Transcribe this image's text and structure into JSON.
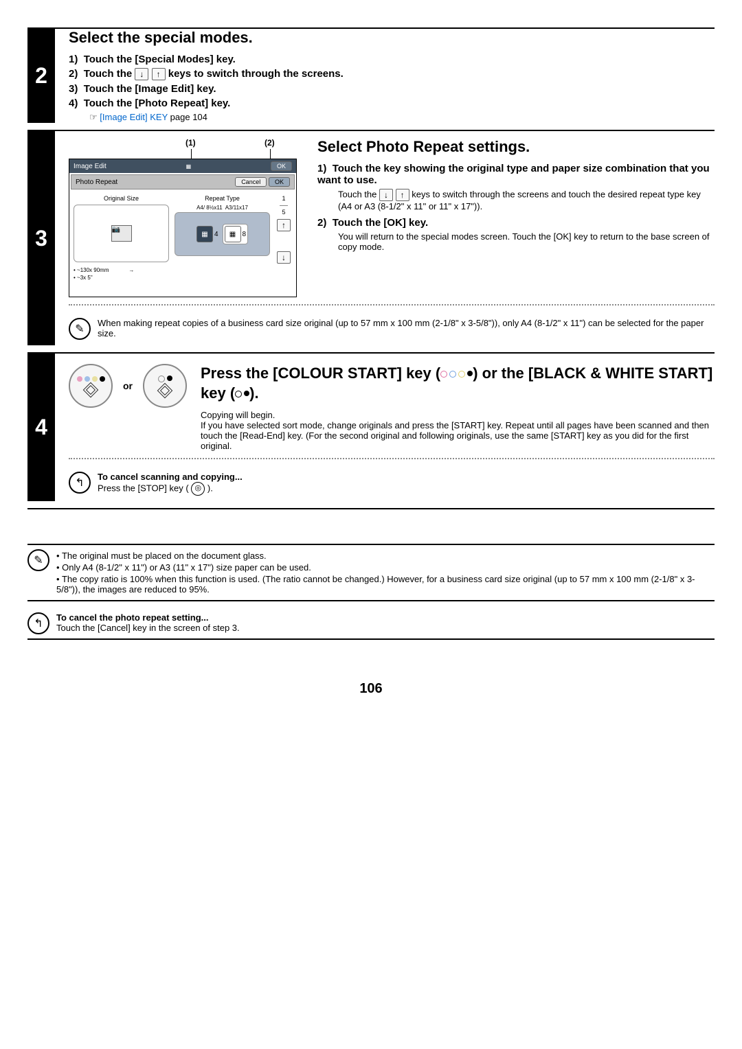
{
  "step2": {
    "title": "Select the special modes.",
    "items": [
      "Touch the [Special Modes] key.",
      "",
      "Touch the [Image Edit] key.",
      "Touch the [Photo Repeat] key."
    ],
    "item2_pre": "Touch the ",
    "item2_post": " keys to switch through the screens.",
    "link_text": "[Image Edit] KEY",
    "link_page": " page 104"
  },
  "step3": {
    "title": "Select Photo Repeat settings.",
    "callout1": "(1)",
    "callout2": "(2)",
    "panel": {
      "header": "Image Edit",
      "sub": "Photo Repeat",
      "ok": "OK",
      "cancel": "Cancel",
      "col1_label": "Original Size",
      "col2_label": "Repeat Type",
      "opt_a4": "A4/ 8½x11",
      "opt_a3": "A3/11x17",
      "count4": "4",
      "count8": "8",
      "page_top": "1",
      "page_bot": "5",
      "size1": "~130x 90mm",
      "size2": "~3x 5\""
    },
    "item1": "Touch the key showing the original type and paper size combination that you want to use.",
    "item1_desc_pre": "Touch the ",
    "item1_desc_post": " keys to switch through the screens and touch the desired repeat type key (A4 or A3 (8-1/2\" x 11\" or 11\" x 17\")).",
    "item2": "Touch the [OK] key.",
    "item2_desc": "You will return to the special modes screen. Touch the [OK] key to return to the base screen of copy mode.",
    "note": "When making repeat copies of a business card size original (up to 57 mm x 100 mm (2-1/8\" x 3-5/8\")), only A4 (8-1/2\" x 11\") can be selected for the paper size."
  },
  "step4": {
    "or": "or",
    "title_line1": "Press the [COLOUR START] key (",
    "title_line2": ") or the [BLACK & WHITE START] key (",
    "title_line3": ").",
    "desc1": "Copying will begin.",
    "desc2": "If you have selected sort mode, change originals and press the [START] key. Repeat until all pages have been scanned and then touch the [Read-End] key. (For the second original and following originals, use the same [START] key as you did for the first original.",
    "cancel_title": "To cancel scanning and copying...",
    "cancel_desc_pre": "Press the [STOP] key ( ",
    "cancel_desc_post": " )."
  },
  "bottom": {
    "n1": "The original must be placed on the document glass.",
    "n2": "Only A4 (8-1/2\" x 11\") or A3 (11\" x 17\") size paper can be used.",
    "n3": "The copy ratio is 100% when this function is used. (The ratio cannot be changed.) However, for a business card size original (up to 57 mm x 100 mm (2-1/8\" x 3-5/8\")), the images are reduced to 95%.",
    "cancel_title": "To cancel the photo repeat setting...",
    "cancel_desc": "Touch the [Cancel] key in the screen of step 3."
  },
  "page_number": "106"
}
